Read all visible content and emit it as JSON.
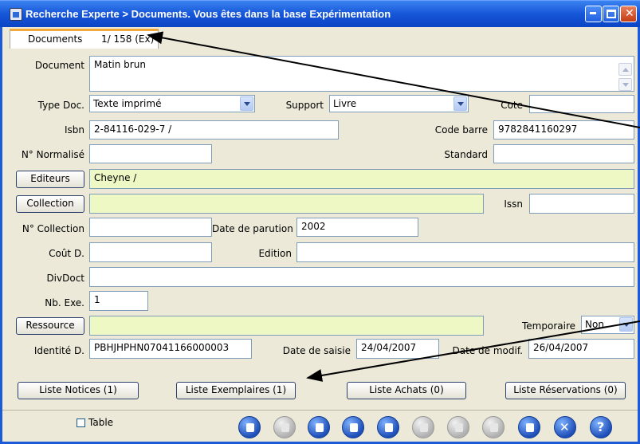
{
  "window": {
    "title": "Recherche Experte > Documents.  Vous êtes dans la base Expérimentation"
  },
  "tab": {
    "label": "Documents",
    "position": "1/ 158 (Ex)"
  },
  "form": {
    "document": {
      "label": "Document",
      "value": "Matin brun"
    },
    "type_doc": {
      "label": "Type Doc.",
      "value": "Texte imprimé"
    },
    "support": {
      "label": "Support",
      "value": "Livre"
    },
    "cote": {
      "label": "Cote",
      "value": ""
    },
    "isbn": {
      "label": "Isbn",
      "value": "2-84116-029-7 /"
    },
    "code_barre": {
      "label": "Code barre",
      "value": "9782841160297"
    },
    "n_normalise": {
      "label": "N° Normalisé",
      "value": ""
    },
    "standard": {
      "label": "Standard",
      "value": ""
    },
    "editeurs": {
      "button": "Editeurs",
      "value": "Cheyne /"
    },
    "collection": {
      "button": "Collection",
      "value": ""
    },
    "issn": {
      "label": "Issn",
      "value": ""
    },
    "n_collection": {
      "label": "N° Collection",
      "value": ""
    },
    "date_parution": {
      "label": "Date de parution",
      "value": "2002"
    },
    "cout": {
      "label": "Coût D.",
      "value": ""
    },
    "edition": {
      "label": "Edition",
      "value": ""
    },
    "divdoct": {
      "label": "DivDoct",
      "value": ""
    },
    "nb_exe": {
      "label": "Nb. Exe.",
      "value": "1"
    },
    "ressource": {
      "button": "Ressource",
      "value": ""
    },
    "temporaire": {
      "label": "Temporaire",
      "value": "Non"
    },
    "identite": {
      "label": "Identité D.",
      "value": "PBHJHPHN07041166000003"
    },
    "date_saisie": {
      "label": "Date de saisie",
      "value": "24/04/2007"
    },
    "date_modif": {
      "label": "Date de modif.",
      "value": "26/04/2007"
    }
  },
  "buttons": {
    "liste_notices": "Liste Notices  (1)",
    "liste_exemplaires": "Liste Exemplaires  (1)",
    "liste_achats": "Liste Achats  (0)",
    "liste_reservations": "Liste Réservations  (0)"
  },
  "toolbar": {
    "table_label": "Table",
    "icons": [
      "new-icon",
      "key-icon",
      "open-book-icon",
      "copy-icon",
      "save-icon",
      "undo-icon",
      "delete-icon",
      "first-record-icon",
      "last-record-icon",
      "close-icon",
      "help-icon"
    ]
  },
  "colors": {
    "titlebar": "#1656d8",
    "form_bg": "#ece9d8",
    "highlight_field": "#eef8c4",
    "tab_accent": "#f2a93b"
  }
}
